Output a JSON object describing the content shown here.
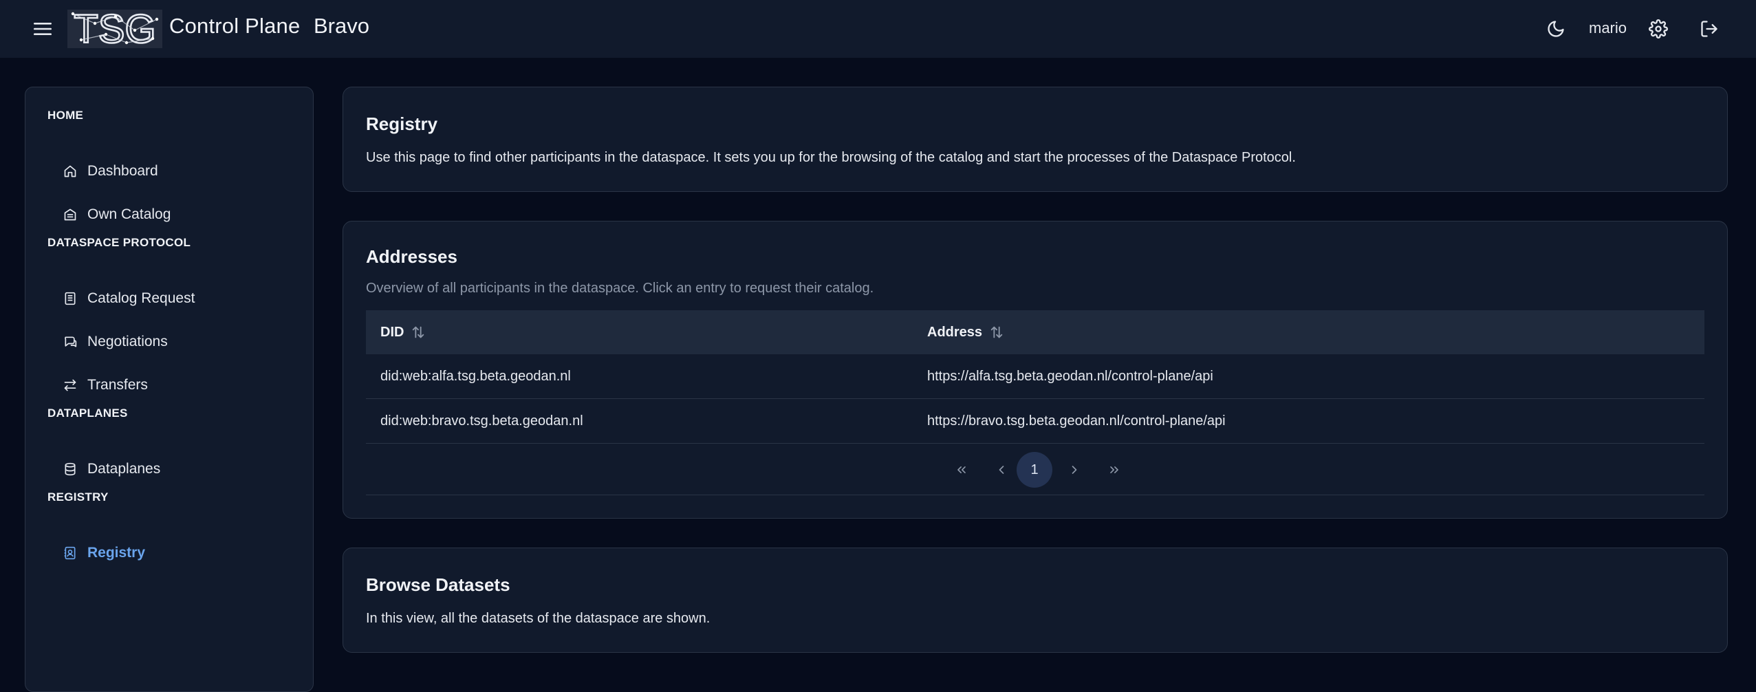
{
  "header": {
    "logo_text": "TSG",
    "app_title": "Control Plane",
    "instance_name": "Bravo",
    "user_name": "mario",
    "icons": [
      "menu-icon",
      "moon-icon",
      "gear-icon",
      "logout-icon"
    ]
  },
  "sidebar": {
    "sections": [
      {
        "label": "HOME",
        "items": [
          {
            "label": "Dashboard",
            "icon": "home-icon"
          },
          {
            "label": "Own Catalog",
            "icon": "catalog-icon"
          }
        ]
      },
      {
        "label": "DATASPACE PROTOCOL",
        "items": [
          {
            "label": "Catalog Request",
            "icon": "document-icon"
          },
          {
            "label": "Negotiations",
            "icon": "chat-icon"
          },
          {
            "label": "Transfers",
            "icon": "transfer-icon"
          }
        ]
      },
      {
        "label": "DATAPLANES",
        "items": [
          {
            "label": "Dataplanes",
            "icon": "database-icon"
          }
        ]
      },
      {
        "label": "REGISTRY",
        "items": [
          {
            "label": "Registry",
            "icon": "contacts-icon",
            "active": true
          }
        ]
      }
    ]
  },
  "registry_card": {
    "title": "Registry",
    "description": "Use this page to find other participants in the dataspace. It sets you up for the browsing of the catalog and start the processes of the Dataspace Protocol."
  },
  "addresses_card": {
    "title": "Addresses",
    "subtitle": "Overview of all participants in the dataspace. Click an entry to request their catalog.",
    "columns": [
      "DID",
      "Address"
    ],
    "rows": [
      [
        "did:web:alfa.tsg.beta.geodan.nl",
        "https://alfa.tsg.beta.geodan.nl/control-plane/api"
      ],
      [
        "did:web:bravo.tsg.beta.geodan.nl",
        "https://bravo.tsg.beta.geodan.nl/control-plane/api"
      ]
    ],
    "pagination": {
      "current_page": "1"
    }
  },
  "browse_card": {
    "title": "Browse Datasets",
    "description": "In this view, all the datasets of the dataspace are shown."
  },
  "colors": {
    "background": "#060c1c",
    "surface": "#111a2c",
    "accent": "#6aa4ec",
    "table_header": "#1f2a3d"
  }
}
